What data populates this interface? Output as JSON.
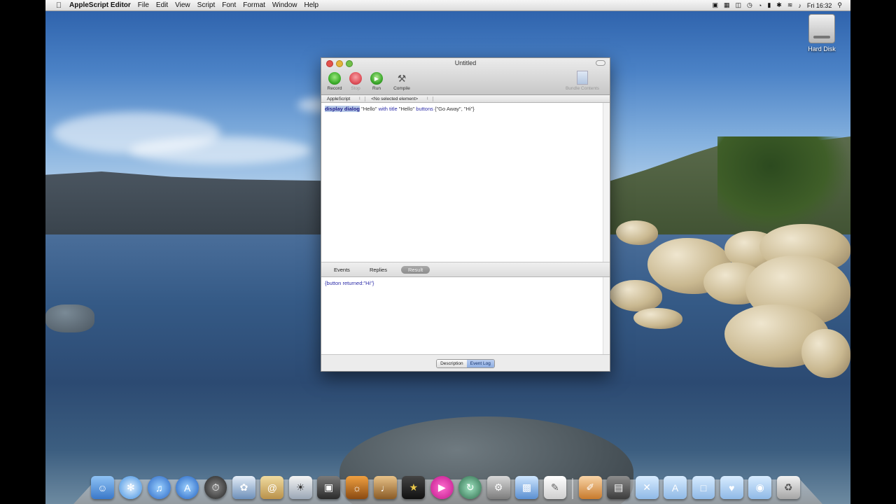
{
  "menubar": {
    "app_name": "AppleScript Editor",
    "items": [
      "File",
      "Edit",
      "View",
      "Script",
      "Font",
      "Format",
      "Window",
      "Help"
    ],
    "clock": "Fri 16:32"
  },
  "desktop": {
    "disk_label": "Hard Disk"
  },
  "window": {
    "title": "Untitled",
    "toolbar": {
      "record": "Record",
      "stop": "Stop",
      "run": "Run",
      "compile": "Compile",
      "bundle_contents": "Bundle Contents"
    },
    "nav": {
      "language": "AppleScript",
      "element": "<No selected element>"
    },
    "script": {
      "keyword_display": "display dialog",
      "str1": " \"Hello\" ",
      "kw_with_title": "with title",
      "str2": " \"Hello\" ",
      "kw_buttons": "buttons",
      "str3": " {\"Go Away\", \"Hi\"}"
    },
    "log_tabs": [
      "Events",
      "Replies",
      "Result"
    ],
    "result_text": "{button returned:\"Hi\"}",
    "bottom_seg": [
      "Description",
      "Event Log"
    ]
  },
  "colors": {
    "record": "#3dae2b",
    "stop": "#e0505a",
    "run": "#3aa72a",
    "selection": "#b7c9e8"
  },
  "dock": {
    "apps": [
      "Finder",
      "Safari",
      "iTunes",
      "App Store",
      "Dashboard",
      "Preview",
      "Address Book",
      "iPhoto",
      "Photo Booth",
      "GarageBand",
      "iMovie",
      "Front Row",
      "Time Machine",
      "Image Capture",
      "iChat",
      "TextEdit",
      "Script Editor",
      "Folder",
      "Applications",
      "Documents",
      "Downloads",
      "Pictures",
      "Trash"
    ]
  }
}
